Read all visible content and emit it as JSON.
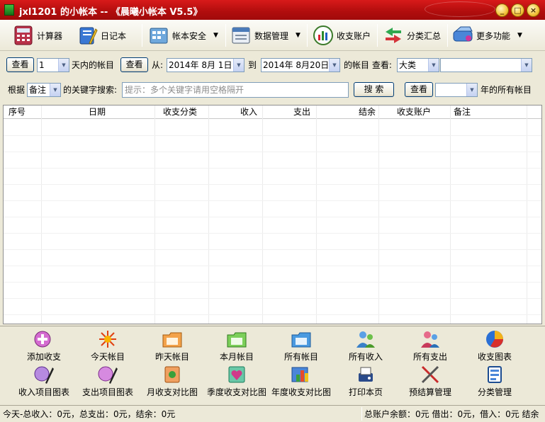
{
  "window": {
    "title": "jxl1201 的小帐本 -- 《晨曦小帐本 V5.5》",
    "min_label": "_",
    "max_label": "□",
    "close_label": "×"
  },
  "toolbar": {
    "items": [
      {
        "label": "计算器",
        "icon": "calculator-icon"
      },
      {
        "label": "日记本",
        "icon": "notebook-icon"
      },
      {
        "label": "帐本安全",
        "icon": "ledger-security-icon",
        "dropdown": true
      },
      {
        "label": "数据管理",
        "icon": "database-icon",
        "dropdown": true
      },
      {
        "label": "收支账户",
        "icon": "accounts-chart-icon"
      },
      {
        "label": "分类汇总",
        "icon": "category-summary-icon"
      },
      {
        "label": "更多功能",
        "icon": "more-functions-icon",
        "dropdown": true
      }
    ],
    "dropdown_arrow": "▼"
  },
  "filter_row1": {
    "view_button": "查看",
    "days_value": "1",
    "days_suffix": "天内的帐目",
    "view_button2": "查看",
    "from_label": "从:",
    "from_date": "2014年 8月 1日",
    "to_label": "到",
    "to_date": "2014年 8月20日",
    "range_suffix": "的帐目 查看:",
    "category_level": "大类",
    "category_value": ""
  },
  "filter_row2": {
    "by_label": "根据",
    "field_value": "备注",
    "keyword_label": "的关键字搜索:",
    "search_placeholder": "提示：多个关键字请用空格隔开",
    "search_button": "搜 索",
    "view_button": "查看",
    "year_value": "",
    "year_suffix": "年的所有帐目"
  },
  "grid": {
    "columns": [
      "序号",
      "日期",
      "收支分类",
      "收入",
      "支出",
      "结余",
      "收支账户",
      "备注"
    ],
    "rows": []
  },
  "panel": {
    "row1": [
      {
        "label": "添加收支",
        "icon": "add-entry-icon"
      },
      {
        "label": "今天帐目",
        "icon": "today-entries-icon"
      },
      {
        "label": "昨天帐目",
        "icon": "yesterday-entries-icon"
      },
      {
        "label": "本月帐目",
        "icon": "month-entries-icon"
      },
      {
        "label": "所有帐目",
        "icon": "all-entries-icon"
      },
      {
        "label": "所有收入",
        "icon": "all-income-icon"
      },
      {
        "label": "所有支出",
        "icon": "all-expense-icon"
      },
      {
        "label": "收支图表",
        "icon": "pie-chart-icon"
      }
    ],
    "row2": [
      {
        "label": "收入项目图表",
        "icon": "income-item-chart-icon"
      },
      {
        "label": "支出项目图表",
        "icon": "expense-item-chart-icon"
      },
      {
        "label": "月收支对比图",
        "icon": "monthly-compare-icon"
      },
      {
        "label": "季度收支对比图",
        "icon": "quarterly-compare-icon"
      },
      {
        "label": "年度收支对比图",
        "icon": "yearly-compare-icon"
      },
      {
        "label": "打印本页",
        "icon": "print-icon"
      },
      {
        "label": "预结算管理",
        "icon": "pre-settlement-icon"
      },
      {
        "label": "分类管理",
        "icon": "category-management-icon"
      }
    ]
  },
  "status": {
    "left": "今天-总收入：0元，总支出：0元，结余：0元",
    "right": "总账户余额：0元 借出：0元，借入：0元 结余"
  },
  "colors": {
    "titlebar": "#c41212",
    "window_bg": "#ece9d8",
    "button_border": "#003c74",
    "input_border": "#7f9db9"
  }
}
